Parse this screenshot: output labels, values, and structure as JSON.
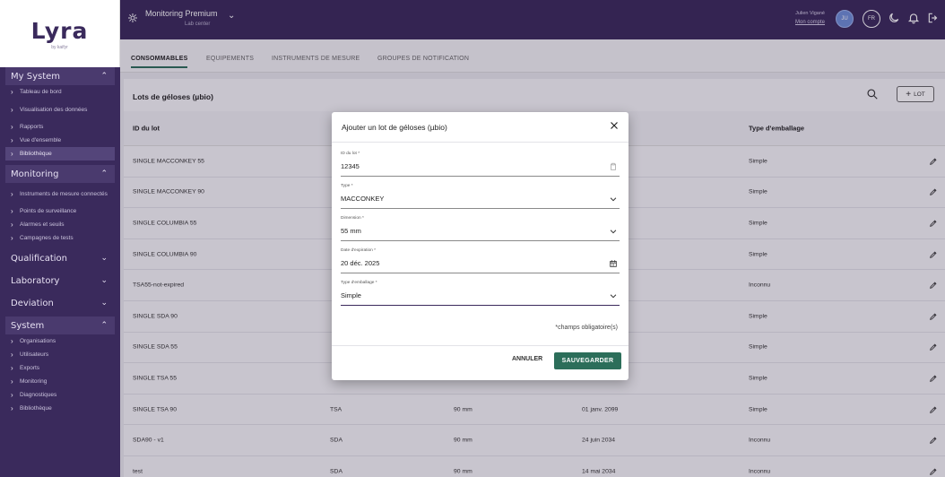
{
  "brand": {
    "logo": "Lyra",
    "logo_sub": "by kaifyr"
  },
  "sidebar": {
    "sections": [
      {
        "label": "My System",
        "expanded": true,
        "items": [
          "Tableau de bord",
          "Visualisation des données",
          "Rapports",
          "Vue d'ensemble",
          "Bibliothèque"
        ],
        "active": 4
      },
      {
        "label": "Monitoring",
        "expanded": true,
        "items": [
          "Instruments de mesure connectés",
          "Points de surveillance",
          "Alarmes et seuils",
          "Campagnes de tests"
        ]
      },
      {
        "label": "Qualification",
        "expanded": false,
        "items": []
      },
      {
        "label": "Laboratory",
        "expanded": false,
        "items": []
      },
      {
        "label": "Deviation",
        "expanded": false,
        "items": []
      },
      {
        "label": "System",
        "expanded": true,
        "items": [
          "Organisations",
          "Utilisateurs",
          "Exports",
          "Monitoring",
          "Diagnostiques",
          "Bibliothèque"
        ]
      }
    ]
  },
  "topbar": {
    "org_name": "Monitoring Premium",
    "org_sub": "Lab center",
    "user_name": "Julien Vigané",
    "user_link": "Mon compte",
    "avatar_initials": "JU",
    "lang": "FR"
  },
  "tabs": [
    "CONSOMMABLES",
    "EQUIPEMENTS",
    "INSTRUMENTS DE MESURE",
    "GROUPES DE NOTIFICATION"
  ],
  "list": {
    "title": "Lots de géloses (µbio)",
    "add_label": "LOT",
    "columns": [
      "ID du lot",
      "",
      "",
      "",
      "Type d'emballage"
    ],
    "rows": [
      [
        "SINGLE MACCONKEY 55",
        "",
        "",
        "",
        "Simple"
      ],
      [
        "SINGLE MACCONKEY 90",
        "",
        "",
        "",
        "Simple"
      ],
      [
        "SINGLE COLUMBIA 55",
        "",
        "",
        "",
        "Simple"
      ],
      [
        "SINGLE COLUMBIA 90",
        "",
        "",
        "",
        "Simple"
      ],
      [
        "TSA55-not-expired",
        "",
        "",
        "",
        "Inconnu"
      ],
      [
        "SINGLE SDA 90",
        "",
        "",
        "",
        "Simple"
      ],
      [
        "SINGLE SDA 55",
        "",
        "",
        "",
        "Simple"
      ],
      [
        "SINGLE TSA 55",
        "",
        "",
        "",
        "Simple"
      ],
      [
        "SINGLE TSA 90",
        "TSA",
        "90 mm",
        "01 janv. 2099",
        "Simple"
      ],
      [
        "SDA90 - v1",
        "SDA",
        "90 mm",
        "24 juin 2034",
        "Inconnu"
      ],
      [
        "test",
        "SDA",
        "90 mm",
        "14 mai 2034",
        "Inconnu"
      ]
    ]
  },
  "modal": {
    "title": "Ajouter un lot de géloses (µbio)",
    "fields": [
      {
        "label": "ID du lot *",
        "value": "12345"
      },
      {
        "label": "Type *",
        "value": "MACCONKEY"
      },
      {
        "label": "Dimension *",
        "value": "55 mm"
      },
      {
        "label": "Date d'expiration *",
        "value": "20 déc. 2025"
      },
      {
        "label": "Type d'emballage *",
        "value": "Simple"
      }
    ],
    "required_note": "*champs obligatoire(s)",
    "cancel": "ANNULER",
    "save": "SAUVEGARDER"
  },
  "colors": {
    "primary": "#3a2a5c",
    "accent": "#2c6e5a"
  }
}
